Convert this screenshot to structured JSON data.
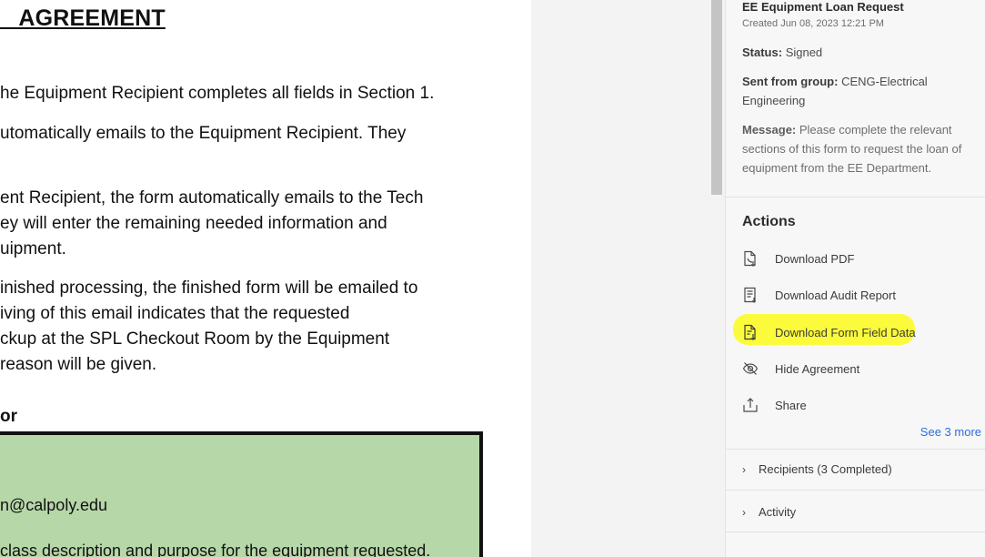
{
  "document": {
    "heading": "_ AGREEMENT",
    "lines": [
      "he Equipment Recipient completes all fields in Section 1.",
      "utomatically emails to the Equipment Recipient. They",
      "ent Recipient, the form automatically emails to the Tech",
      "ey will enter the remaining needed information and",
      "uipment.",
      "inished processing, the finished form will be emailed to",
      "iving of this email indicates that the requested",
      "ckup at the SPL Checkout Room by the Equipment",
      "reason will be given."
    ],
    "section_label": "or",
    "email": "n@calpoly.edu",
    "description": "class description and purpose for the equipment requested."
  },
  "panel": {
    "agreement_title": "EE Equipment Loan Request",
    "created": "Created Jun 08, 2023 12:21 PM",
    "status_label": "Status:",
    "status_value": "Signed",
    "group_label": "Sent from group:",
    "group_value": "CENG-Electrical Engineering",
    "message_label": "Message:",
    "message_value": "Please complete the relevant sections of this form to request the loan of equipment from the EE Department.",
    "actions_title": "Actions",
    "actions": [
      {
        "label": "Download PDF",
        "icon": "pdf-download-icon"
      },
      {
        "label": "Download Audit Report",
        "icon": "audit-report-icon"
      },
      {
        "label": "Download Form Field Data",
        "icon": "form-data-download-icon"
      },
      {
        "label": "Hide Agreement",
        "icon": "eye-slash-icon"
      },
      {
        "label": "Share",
        "icon": "share-icon"
      }
    ],
    "see_more": "See 3 more",
    "recipients": "Recipients (3 Completed)",
    "activity": "Activity",
    "highlight_color": "#fbfb3c",
    "link_color": "#2a6fdb"
  }
}
